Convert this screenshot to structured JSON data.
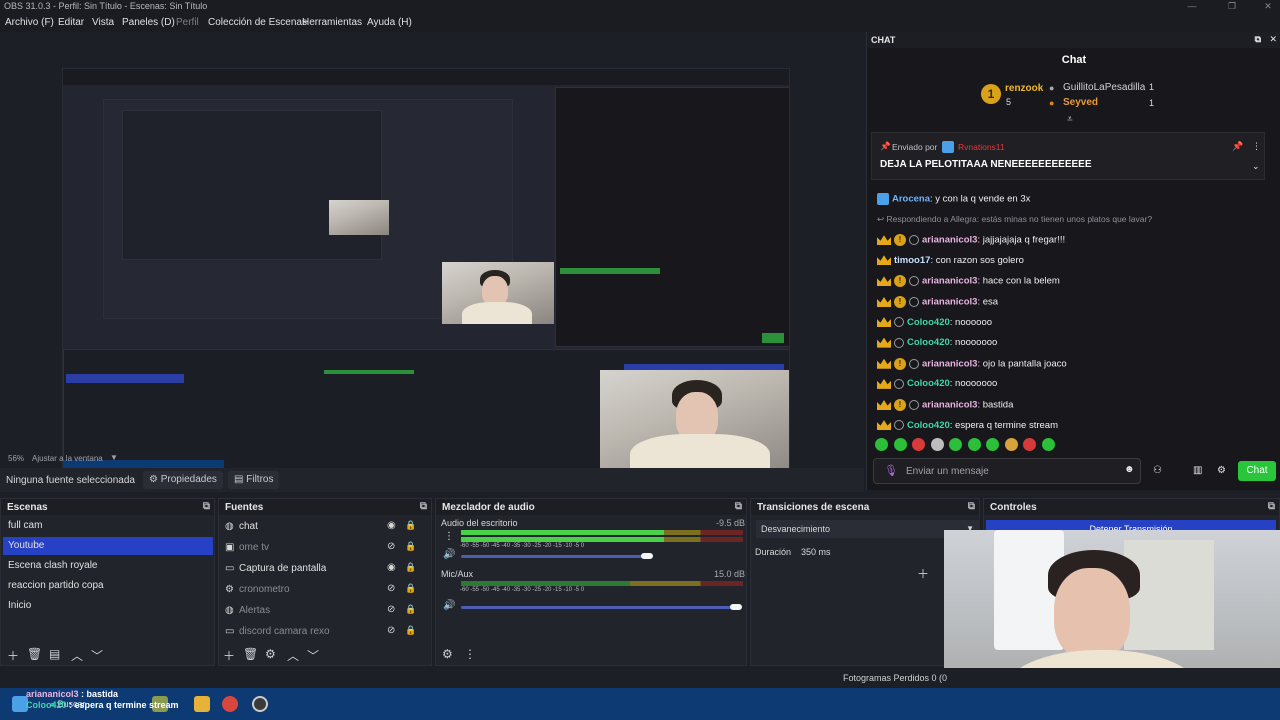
{
  "window": {
    "title": "OBS 31.0.3 - Perfil: Sin Título - Escenas: Sin Título"
  },
  "menu": [
    "Archivo (F)",
    "Editar",
    "Vista",
    "Paneles (D)",
    "Perfil",
    "Colección de Escenas",
    "Herramientas",
    "Ayuda (H)"
  ],
  "preview": {
    "zoom": "56%",
    "fit_label": "Ajustar a la ventana"
  },
  "props_row": {
    "no_source": "Ninguna fuente seleccionada",
    "properties": "Propiedades",
    "filters": "Filtros"
  },
  "scenes": {
    "title": "Escenas",
    "items": [
      "full cam",
      "Youtube",
      "Escena clash royale",
      "reaccion partido copa",
      "Inicio"
    ],
    "selected_index": 1
  },
  "sources": {
    "title": "Fuentes",
    "items": [
      {
        "name": "chat",
        "icon": "globe-icon",
        "visible": true
      },
      {
        "name": "ome tv",
        "icon": "camera-icon",
        "visible": false
      },
      {
        "name": "Captura de pantalla",
        "icon": "monitor-icon",
        "visible": true
      },
      {
        "name": "cronometro",
        "icon": "gear-icon",
        "visible": false
      },
      {
        "name": "Alertas",
        "icon": "globe-icon",
        "visible": false
      },
      {
        "name": "discord camara rexo",
        "icon": "monitor-icon",
        "visible": false
      }
    ]
  },
  "mixer": {
    "title": "Mezclador de audio",
    "channels": [
      {
        "name": "Audio del escritorio",
        "db": "-9.5 dB",
        "level": 0.72
      },
      {
        "name": "Mic/Aux",
        "db": "15.0 dB",
        "level": 0.0
      }
    ],
    "ticks": "-60  -55  -50  -45  -40  -35  -30  -25  -20  -15  -10  -5  0"
  },
  "transitions": {
    "title": "Transiciones de escena",
    "selected": "Desvanecimiento",
    "duration_label": "Duración",
    "duration_value": "350 ms"
  },
  "controls": {
    "title": "Controles",
    "stop_stream": "Detener Transmisión"
  },
  "status": {
    "frames_dropped": "Fotogramas Perdidos 0 (0"
  },
  "taskbar": {
    "search": "Buscar"
  },
  "overlay": {
    "line1_user": "ariananicol3",
    "line1_text": " : bastida",
    "line2_user": "Coloo420",
    "line2_text": " : espera q termine stream"
  },
  "chat": {
    "dock_title": "CHAT",
    "title": "Chat",
    "leaderboard": {
      "first": {
        "name": "renzook",
        "count": "5"
      },
      "second": {
        "name": "GuillitoLaPesadilla",
        "count": "1"
      },
      "third": {
        "name": "Seyved",
        "count": "1"
      }
    },
    "pinned": {
      "label": "Enviado por",
      "user": "Rvnations11",
      "text": "DEJA LA PELOTITAAA NENEEEEEEEEEEEE"
    },
    "messages": [
      {
        "user": "Arocena",
        "text": ": y con la q vende en 3x",
        "color": "#6bb3ff",
        "badges": "b"
      },
      {
        "reply": "Respondiendo a Allegra: estás minas no tienen unos platos que lavar?"
      },
      {
        "user": "ariananicol3",
        "text": ": jajjajajaja q fregar!!!",
        "color": "#e8b4e0",
        "badges": "cor"
      },
      {
        "user": "timoo17",
        "text": ": con razon sos golero",
        "color": "#c8e0ff",
        "badges": "c"
      },
      {
        "user": "ariananicol3",
        "text": ": hace con la belem",
        "color": "#e8b4e0",
        "badges": "cor"
      },
      {
        "user": "ariananicol3",
        "text": ": esa",
        "color": "#e8b4e0",
        "badges": "cor"
      },
      {
        "user": "Coloo420",
        "text": ": noooooo",
        "color": "#3fd6a8",
        "badges": "cr"
      },
      {
        "user": "Coloo420",
        "text": ": nooooooo",
        "color": "#3fd6a8",
        "badges": "cr"
      },
      {
        "user": "ariananicol3",
        "text": ": ojo la pantalla joaco",
        "color": "#e8b4e0",
        "badges": "cor"
      },
      {
        "user": "Coloo420",
        "text": ": nooooooo",
        "color": "#3fd6a8",
        "badges": "cr"
      },
      {
        "user": "ariananicol3",
        "text": ": bastida",
        "color": "#e8b4e0",
        "badges": "cor"
      },
      {
        "user": "Coloo420",
        "text": ": espera q termine stream",
        "color": "#3fd6a8",
        "badges": "cr"
      }
    ],
    "input_placeholder": "Enviar un mensaje",
    "send_label": "Chat"
  },
  "colors": {
    "accent": "#2741c4",
    "chat_send": "#29c53a",
    "taskbar": "#0e3a74"
  }
}
